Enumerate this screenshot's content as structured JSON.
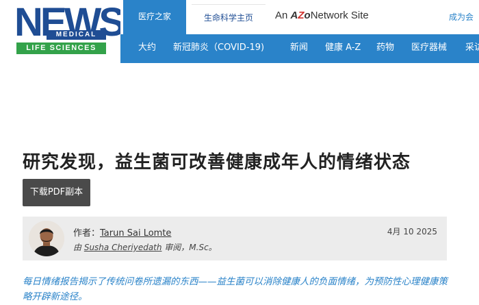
{
  "logo": {
    "news": "NEWS",
    "medical": "MEDICAL",
    "life_sciences": "LIFE SCIENCES"
  },
  "topbar": {
    "tab_medical": "医疗之家",
    "tab_life": "生命科学主页",
    "network_prefix": "An ",
    "network_mark_a": "A",
    "network_mark_z": "Z",
    "network_mark_o": "o",
    "network_suffix": "Network Site",
    "become": "成为会"
  },
  "nav": {
    "items": [
      "大约",
      "新冠肺炎（COVID-19)",
      "新闻",
      "健康 A-Z",
      "药物",
      "医疗器械",
      "采访"
    ]
  },
  "article": {
    "headline": "研究发现，益生菌可改善健康成年人的情绪状态",
    "pdf_button": "下载PDF副本",
    "author_label": "作者：",
    "author_name": "Tarun Sai Lomte",
    "date": "4月 10 2025",
    "review_prefix": "由 ",
    "reviewer_name": "Susha Cheriyedath",
    "review_suffix": " 审阅，M.Sc。",
    "lead": "每日情绪报告揭示了传统问卷所遗漏的东西——益生菌可以消除健康人的负面情绪，为预防性心理健康策略开辟新途径。"
  },
  "colors": {
    "brand_blue": "#1f4d94",
    "brand_green": "#33a24a",
    "nav_blue": "#2a83c9"
  }
}
